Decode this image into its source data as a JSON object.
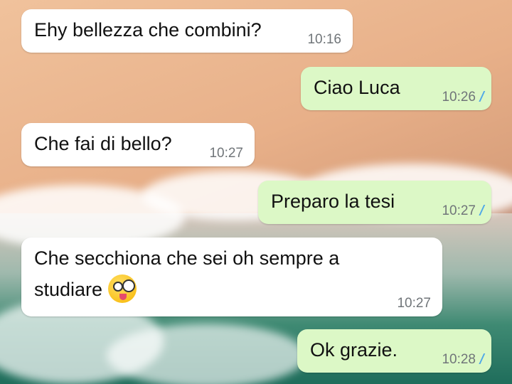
{
  "colors": {
    "incoming": "#ffffff",
    "outgoing": "#dcf8c6",
    "read_check": "#4fa8e8",
    "time": "#707579"
  },
  "messages": [
    {
      "dir": "in",
      "text": "Ehy bellezza che combini?",
      "time": "10:16"
    },
    {
      "dir": "out",
      "text": "Ciao Luca",
      "time": "10:26",
      "status_icon": "double-check-read-icon"
    },
    {
      "dir": "in",
      "text": "Che fai di bello?",
      "time": "10:27"
    },
    {
      "dir": "out",
      "text": "Preparo la tesi",
      "time": "10:27",
      "status_icon": "double-check-read-icon"
    },
    {
      "dir": "in",
      "text_line1": "Che secchiona che sei oh sempre a",
      "text_line2": "studiare",
      "emoji": "zany-face-icon",
      "time": "10:27"
    },
    {
      "dir": "out",
      "text": "Ok grazie.",
      "time": "10:28",
      "status_icon": "double-check-read-icon"
    }
  ]
}
